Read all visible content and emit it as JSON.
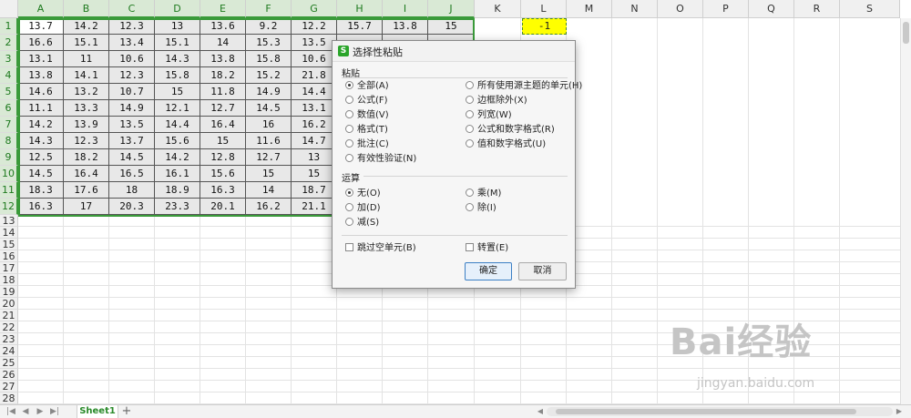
{
  "columns": [
    "A",
    "B",
    "C",
    "D",
    "E",
    "F",
    "G",
    "H",
    "I",
    "J",
    "K",
    "L",
    "M",
    "N",
    "O",
    "P",
    "Q",
    "R",
    "S"
  ],
  "rows": [
    "1",
    "2",
    "3",
    "4",
    "5",
    "6",
    "7",
    "8",
    "9",
    "10",
    "11",
    "12",
    "13",
    "14",
    "15",
    "16",
    "17",
    "18",
    "19",
    "20",
    "21",
    "22",
    "23",
    "24",
    "25",
    "26",
    "27",
    "28"
  ],
  "cells": [
    [
      "13.7",
      "14.2",
      "12.3",
      "13",
      "13.6",
      "9.2",
      "12.2",
      "15.7",
      "13.8",
      "15"
    ],
    [
      "16.6",
      "15.1",
      "13.4",
      "15.1",
      "14",
      "15.3",
      "13.5",
      "",
      "",
      ""
    ],
    [
      "13.1",
      "11",
      "10.6",
      "14.3",
      "13.8",
      "15.8",
      "10.6",
      "",
      "",
      ""
    ],
    [
      "13.8",
      "14.1",
      "12.3",
      "15.8",
      "18.2",
      "15.2",
      "21.8",
      "",
      "",
      ""
    ],
    [
      "14.6",
      "13.2",
      "10.7",
      "15",
      "11.8",
      "14.9",
      "14.4",
      "",
      "",
      ""
    ],
    [
      "11.1",
      "13.3",
      "14.9",
      "12.1",
      "12.7",
      "14.5",
      "13.1",
      "",
      "",
      ""
    ],
    [
      "14.2",
      "13.9",
      "13.5",
      "14.4",
      "16.4",
      "16",
      "16.2",
      "",
      "",
      ""
    ],
    [
      "14.3",
      "12.3",
      "13.7",
      "15.6",
      "15",
      "11.6",
      "14.7",
      "",
      "",
      ""
    ],
    [
      "12.5",
      "18.2",
      "14.5",
      "14.2",
      "12.8",
      "12.7",
      "13",
      "",
      "",
      ""
    ],
    [
      "14.5",
      "16.4",
      "16.5",
      "16.1",
      "15.6",
      "15",
      "15",
      "",
      "",
      ""
    ],
    [
      "18.3",
      "17.6",
      "18",
      "18.9",
      "16.3",
      "14",
      "18.7",
      "",
      "",
      ""
    ],
    [
      "16.3",
      "17",
      "20.3",
      "23.3",
      "20.1",
      "16.2",
      "21.1",
      "",
      "",
      ""
    ]
  ],
  "cell_L1": "-1",
  "sheet_tab": "Sheet1",
  "add_tab": "+",
  "dialog": {
    "title": "选择性粘贴",
    "logo": "S",
    "paste_label": "粘贴",
    "paste_left": [
      "全部(A)",
      "公式(F)",
      "数值(V)",
      "格式(T)",
      "批注(C)",
      "有效性验证(N)"
    ],
    "paste_right": [
      "所有使用源主题的单元(H)",
      "边框除外(X)",
      "列宽(W)",
      "公式和数字格式(R)",
      "值和数字格式(U)"
    ],
    "operation_label": "运算",
    "op_left": [
      "无(O)",
      "加(D)",
      "减(S)"
    ],
    "op_right": [
      "乘(M)",
      "除(I)"
    ],
    "skip_blanks": "跳过空单元(B)",
    "transpose": "转置(E)",
    "ok": "确定",
    "cancel": "取消"
  },
  "watermark": {
    "big": "Bai经验",
    "small": "jingyan.baidu.com"
  },
  "colors": {
    "selection": "#3a9a3a",
    "highlight": "#ffff00",
    "tab_text": "#2a8a2a"
  }
}
